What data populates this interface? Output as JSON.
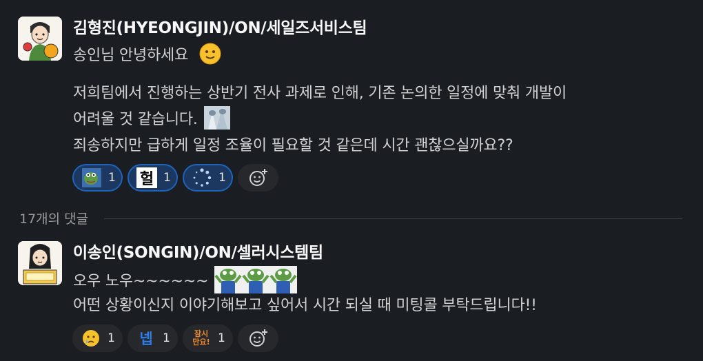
{
  "messages": [
    {
      "author": "김형진(HYEONGJIN)/ON/세일즈서비스팀",
      "lines": [
        "송인님  안녕하세요",
        "저희팀에서 진행하는 상반기 전사 과제로 인해, 기존 논의한 일정에 맞춰 개발이",
        "어려울 것 같습니다.",
        "죄송하지만 급하게 일정 조율이 필요할 것 같은데 시간 괜찮으실까요??"
      ],
      "reactions": [
        {
          "icon": "frog-meme-icon",
          "count": "1",
          "mine": true
        },
        {
          "icon": "heol-text-icon",
          "label": "헐",
          "count": "1",
          "mine": true
        },
        {
          "icon": "loading-spinner-icon",
          "count": "1",
          "mine": true
        }
      ]
    },
    {
      "author": "이송인(SONGIN)/ON/셀러시스템팀",
      "lines": [
        "오우 노우~~~~~~",
        "어떤 상황이신지 이야기해보고 싶어서 시간 되실 때 미팅콜 부탁드립니다!!"
      ],
      "reactions": [
        {
          "icon": "crying-face-icon",
          "count": "1",
          "mine": false
        },
        {
          "icon": "nep-text-icon",
          "label": "넵",
          "count": "1",
          "mine": false
        },
        {
          "icon": "wait-please-icon",
          "label_top": "잠시",
          "label_bottom": "만요!",
          "count": "1",
          "mine": false
        }
      ]
    }
  ],
  "thread": {
    "reply_count_label": "17개의 댓글"
  },
  "colors": {
    "background": "#1a1d21",
    "reaction_mine_border": "#1d64bd",
    "reaction_mine_bg": "#1c3860"
  }
}
